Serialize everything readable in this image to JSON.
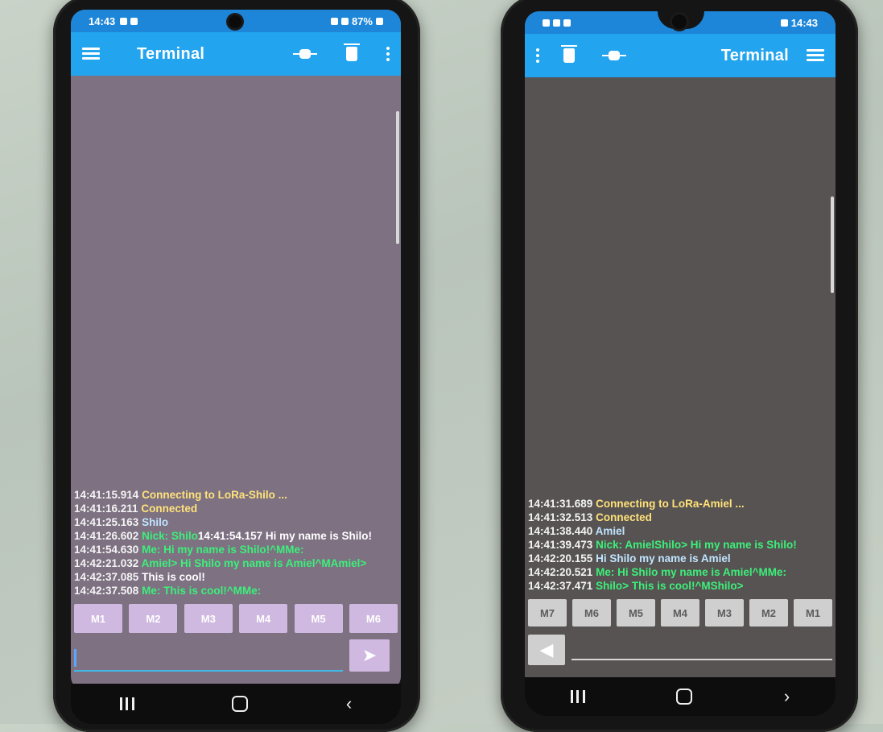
{
  "left_phone": {
    "status": {
      "time": "14:43",
      "battery": "87%"
    },
    "toolbar": {
      "title": "Terminal",
      "icons": [
        "hamburger-icon",
        "plug-icon",
        "trash-icon",
        "more-vert-icon"
      ]
    },
    "log": [
      {
        "ts": "14:41:15.914",
        "text": "Connecting to LoRa-Shilo ...",
        "color": "yellow"
      },
      {
        "ts": "14:41:16.211",
        "text": "Connected",
        "color": "yellow"
      },
      {
        "ts": "14:41:25.163",
        "text": "Shilo",
        "color": "blue"
      },
      {
        "ts": "14:41:26.602",
        "text": "Nick: Shilo",
        "color": "green",
        "extra": "14:41:54.157 Hi my name is Shilo!",
        "extra_color": "white"
      },
      {
        "ts": "14:41:54.630",
        "text": "Me: Hi my name is Shilo!^MMe:",
        "color": "green"
      },
      {
        "ts": "14:42:21.032",
        "text": "Amiel> Hi Shilo my name is Amiel^MAmiel>",
        "color": "green"
      },
      {
        "ts": "14:42:37.085",
        "text": "This is cool!",
        "color": "white"
      },
      {
        "ts": "14:42:37.508",
        "text": "Me: This is cool!^MMe:",
        "color": "green"
      }
    ],
    "macros": [
      "M1",
      "M2",
      "M3",
      "M4",
      "M5",
      "M6"
    ],
    "input_value": "",
    "send_icon": "send-icon"
  },
  "right_phone": {
    "status": {
      "time": "14:43"
    },
    "toolbar": {
      "title": "Terminal",
      "icons": [
        "more-vert-icon",
        "trash-icon",
        "plug-icon",
        "hamburger-icon"
      ]
    },
    "log": [
      {
        "ts": "14:41:31.689",
        "text": "Connecting to LoRa-Amiel ...",
        "color": "yellow"
      },
      {
        "ts": "14:41:32.513",
        "text": "Connected",
        "color": "yellow"
      },
      {
        "ts": "14:41:38.440",
        "text": "Amiel",
        "color": "blue"
      },
      {
        "ts": "14:41:39.473",
        "text": "Nick: AmielShilo> Hi my name is Shilo!",
        "color": "green"
      },
      {
        "ts": "14:42:20.155",
        "text": "Hi Shilo my name is Amiel",
        "color": "blue"
      },
      {
        "ts": "14:42:20.521",
        "text": "Me: Hi Shilo my name is Amiel^MMe:",
        "color": "green"
      },
      {
        "ts": "14:42:37.471",
        "text": "Shilo> This is cool!^MShilo>",
        "color": "green"
      }
    ],
    "macros": [
      "M7",
      "M6",
      "M5",
      "M4",
      "M3",
      "M2",
      "M1"
    ],
    "input_value": "",
    "send_icon": "send-icon"
  }
}
